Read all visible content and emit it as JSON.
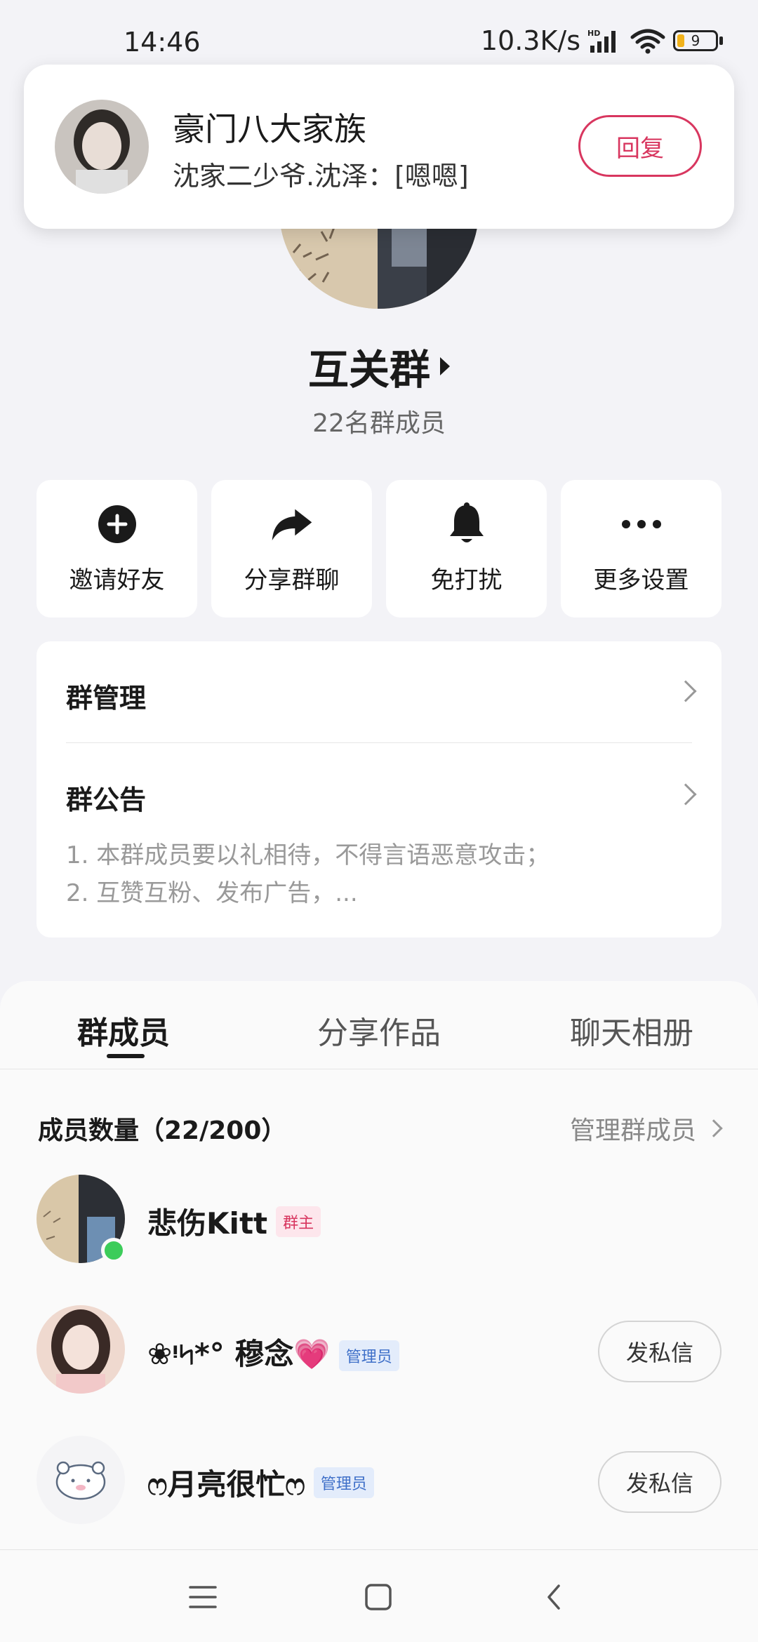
{
  "status_bar": {
    "time": "14:46",
    "net_speed": "10.3K/s",
    "battery_level": "9",
    "icons": [
      "hd-signal-icon",
      "wifi-icon",
      "battery-icon"
    ]
  },
  "notification": {
    "title": "豪门八大家族",
    "message": "沈家二少爷.沈泽：[嗯嗯]",
    "reply_label": "回复"
  },
  "group": {
    "name": "互关群",
    "member_count": "22名群成员"
  },
  "actions": [
    {
      "label": "邀请好友",
      "icon": "plus-circle-icon"
    },
    {
      "label": "分享群聊",
      "icon": "share-arrow-icon"
    },
    {
      "label": "免打扰",
      "icon": "bell-icon"
    },
    {
      "label": "更多设置",
      "icon": "more-dots-icon"
    }
  ],
  "settings": {
    "manage_label": "群管理",
    "notice_label": "群公告",
    "notice_line1": "1. 本群成员要以礼相待，不得言语恶意攻击；",
    "notice_line2": "2. 互赞互粉、发布广告，..."
  },
  "tabs": [
    {
      "label": "群成员",
      "active": true
    },
    {
      "label": "分享作品",
      "active": false
    },
    {
      "label": "聊天相册",
      "active": false
    }
  ],
  "members_section": {
    "header": "成员数量（22/200）",
    "manage_link": "管理群成员",
    "members": [
      {
        "name": "悲伤Kitt",
        "badge": "群主",
        "online": true
      },
      {
        "name": "❀ᵎ৸*° 穆念💗",
        "badge": "管理员",
        "dm_label": "发私信"
      },
      {
        "name": "ෆ月亮很忙ෆ",
        "badge": "管理员",
        "dm_label": "发私信"
      }
    ]
  },
  "colors": {
    "accent": "#d8365f",
    "admin_badge": "#3e6fc8",
    "online": "#3ccc5a",
    "battery_fill": "#f1b21b"
  }
}
